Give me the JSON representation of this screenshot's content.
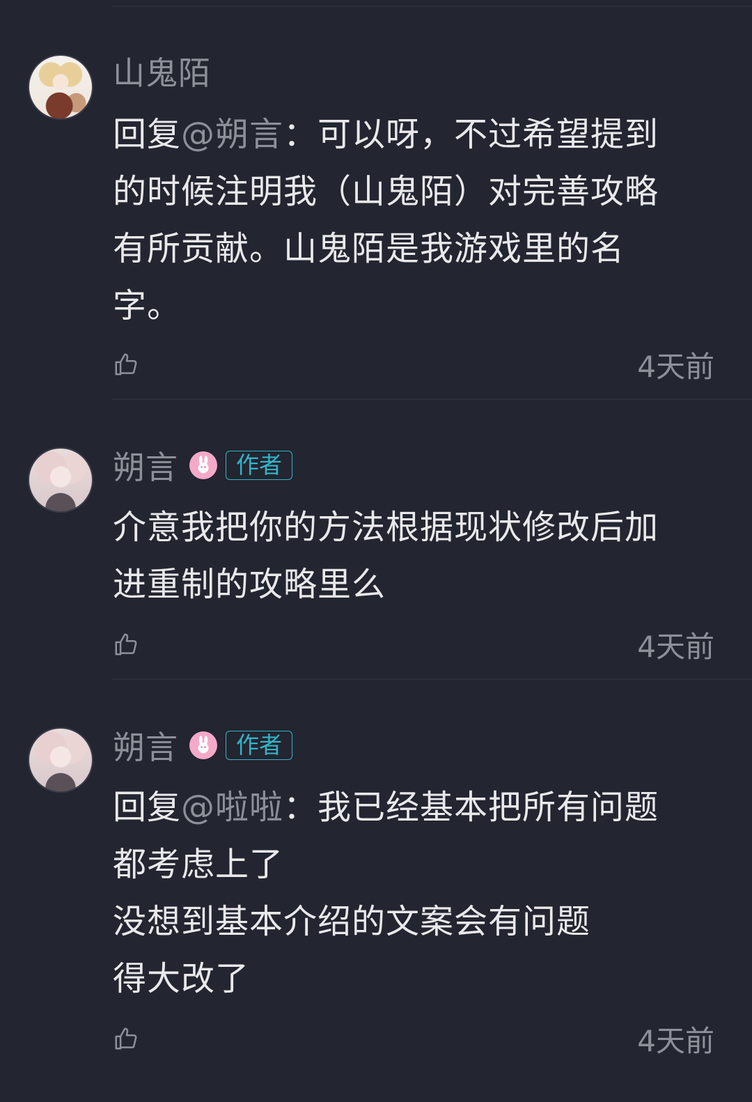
{
  "comments": [
    {
      "username": "山鬼陌",
      "is_author": false,
      "reply_prefix": "回复",
      "reply_to": "@朔言",
      "reply_sep": "：",
      "lines": [
        "可以呀，不过希望提到",
        "的时候注明我（山鬼陌）对完善攻略",
        "有所贡献。山鬼陌是我游戏里的名",
        "字。"
      ],
      "time": "4天前"
    },
    {
      "username": "朔言",
      "is_author": true,
      "author_label": "作者",
      "lines": [
        "介意我把你的方法根据现状修改后加",
        "进重制的攻略里么"
      ],
      "time": "4天前"
    },
    {
      "username": "朔言",
      "is_author": true,
      "author_label": "作者",
      "reply_prefix": "回复",
      "reply_to": "@啦啦",
      "reply_sep": "：",
      "lines": [
        "我已经基本把所有问题",
        "都考虑上了",
        "没想到基本介绍的文案会有问题",
        "得大改了"
      ],
      "time": "4天前"
    }
  ],
  "colors": {
    "background": "#232530",
    "text": "#e9e9ec",
    "muted": "#8d8f99",
    "author_tag": "#33b4c9",
    "badge": "#f4a9c8"
  },
  "icons": {
    "like": "thumbs-up-outline-icon",
    "badge": "pink-rabbit-badge-icon"
  }
}
